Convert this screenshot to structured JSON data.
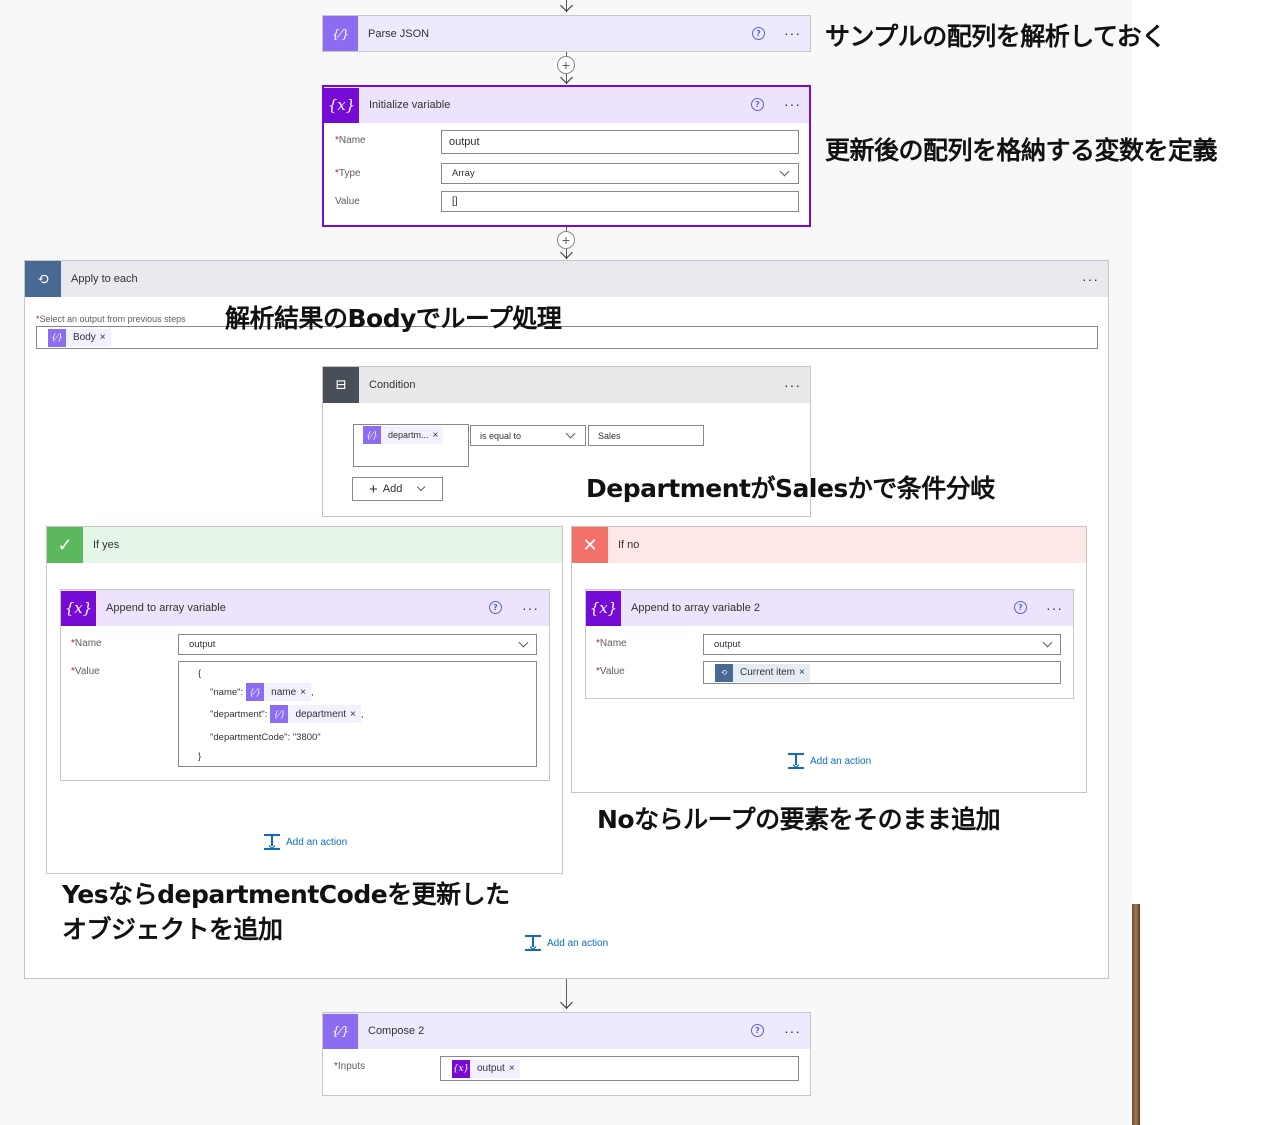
{
  "parse_json": {
    "title": "Parse JSON",
    "help": "?",
    "more": "···"
  },
  "init_var": {
    "title": "Initialize variable",
    "help": "?",
    "more": "···",
    "name_label": "Name",
    "name_value": "output",
    "type_label": "Type",
    "type_value": "Array",
    "value_label": "Value",
    "value_value": "[]"
  },
  "apply_each": {
    "title": "Apply to each",
    "more": "···",
    "select_label": "Select an output from previous steps",
    "token": "Body"
  },
  "condition": {
    "title": "Condition",
    "more": "···",
    "left_token": "departm...",
    "operator": "is equal to",
    "right_value": "Sales",
    "add_label": "Add"
  },
  "if_yes": {
    "title": "If yes",
    "action": {
      "title": "Append to array variable",
      "help": "?",
      "more": "···",
      "name_label": "Name",
      "name_value": "output",
      "value_label": "Value",
      "code": {
        "open": "{",
        "name_key": "\"name\":",
        "name_token": "name",
        "dept_key": "\"department\":",
        "dept_token": "department",
        "code_line": "\"departmentCode\": \"3800\"",
        "close": "}",
        "comma": ","
      }
    },
    "add_action": "Add an action"
  },
  "if_no": {
    "title": "If no",
    "action": {
      "title": "Append to array variable 2",
      "help": "?",
      "more": "···",
      "name_label": "Name",
      "name_value": "output",
      "value_label": "Value",
      "value_token": "Current item"
    },
    "add_action": "Add an action"
  },
  "loop_add_action": "Add an action",
  "compose": {
    "title": "Compose 2",
    "help": "?",
    "more": "···",
    "inputs_label": "Inputs",
    "inputs_token": "output"
  },
  "annotations": {
    "a1": "サンプルの配列を解析しておく",
    "a2": "更新後の配列を格納する変数を定義",
    "a3": "解析結果のBodyでループ処理",
    "a4": "DepartmentがSalesかで条件分岐",
    "a5": "Noならループの要素をそのまま追加",
    "a6_line1": "YesならdepartmentCodeを更新した",
    "a6_line2": "オブジェクトを追加"
  },
  "token_close": "×",
  "required_mark": "*",
  "colors": {
    "variable_purple": "#770bd6",
    "variable_header": "#ede3fc",
    "data_op_purple": "#8c6cf0",
    "loop_gray": "#486991",
    "condition_gray": "#484f58",
    "yes_green": "#5cb85c",
    "no_red": "#f2726b",
    "link_blue": "#0f6cbd"
  }
}
